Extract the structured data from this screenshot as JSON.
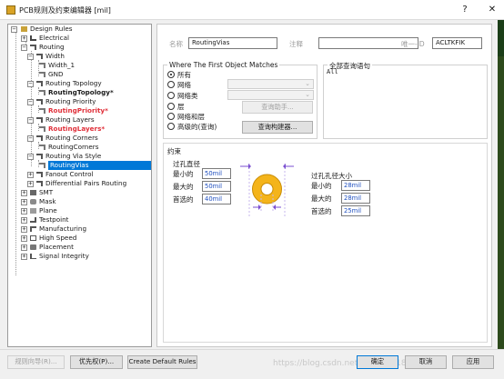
{
  "window": {
    "title": "PCB规则及约束编辑器 [mil]",
    "help_glyph": "?",
    "close_glyph": "✕"
  },
  "tree": {
    "items": [
      {
        "label": "Design Rules",
        "icon": "design-rules-icon",
        "expanded": true
      },
      {
        "label": "Electrical",
        "icon": "electrical-icon",
        "expanded": false
      },
      {
        "label": "Routing",
        "icon": "routing-icon",
        "expanded": true
      },
      {
        "label": "Width",
        "icon": "rule-class-icon",
        "expanded": true
      },
      {
        "label": "Width_1",
        "icon": "rule-icon"
      },
      {
        "label": "GND",
        "icon": "rule-icon"
      },
      {
        "label": "Routing Topology",
        "icon": "rule-class-icon",
        "expanded": true
      },
      {
        "label": "RoutingTopology*",
        "icon": "rule-icon",
        "modified": true
      },
      {
        "label": "Routing Priority",
        "icon": "rule-class-icon",
        "expanded": true
      },
      {
        "label": "RoutingPriority*",
        "icon": "rule-icon",
        "modified": true
      },
      {
        "label": "Routing Layers",
        "icon": "rule-class-icon",
        "expanded": true
      },
      {
        "label": "RoutingLayers*",
        "icon": "rule-icon",
        "modified": true
      },
      {
        "label": "Routing Corners",
        "icon": "rule-class-icon",
        "expanded": true
      },
      {
        "label": "RoutingCorners",
        "icon": "rule-icon"
      },
      {
        "label": "Routing Via Style",
        "icon": "rule-class-icon",
        "expanded": true
      },
      {
        "label": "RoutingVias",
        "icon": "rule-icon",
        "selected": true
      },
      {
        "label": "Fanout Control",
        "icon": "rule-class-icon",
        "expanded": false
      },
      {
        "label": "Differential Pairs Routing",
        "icon": "rule-class-icon",
        "expanded": false
      },
      {
        "label": "SMT",
        "icon": "smt-icon",
        "expanded": false
      },
      {
        "label": "Mask",
        "icon": "mask-icon",
        "expanded": false
      },
      {
        "label": "Plane",
        "icon": "plane-icon",
        "expanded": false
      },
      {
        "label": "Testpoint",
        "icon": "testpoint-icon",
        "expanded": false
      },
      {
        "label": "Manufacturing",
        "icon": "manufacturing-icon",
        "expanded": false
      },
      {
        "label": "High Speed",
        "icon": "high-speed-icon",
        "expanded": false
      },
      {
        "label": "Placement",
        "icon": "placement-icon",
        "expanded": false
      },
      {
        "label": "Signal Integrity",
        "icon": "signal-integrity-icon",
        "expanded": false
      }
    ]
  },
  "rule": {
    "name_label": "名称",
    "name_value": "RoutingVias",
    "comment_label": "注释",
    "comment_value": "",
    "uid_label": "唯一-ID",
    "uid_value": "ACLTKFIK"
  },
  "match": {
    "title": "Where The First Object Matches",
    "options": [
      "所有",
      "网络",
      "网络类",
      "层",
      "网络和层",
      "高级的(查询)"
    ],
    "selected_option": "所有",
    "query_helper": "查询助手...",
    "query_builder": "查询构建器..."
  },
  "full_query": {
    "title": "全部查询语句",
    "text": "All"
  },
  "constraints": {
    "title": "约束",
    "via_diameter": {
      "title": "过孔直径",
      "rows": [
        {
          "label": "最小的",
          "value": "50mil"
        },
        {
          "label": "最大的",
          "value": "50mil"
        },
        {
          "label": "首选的",
          "value": "40mil"
        }
      ]
    },
    "hole_size": {
      "title": "过孔孔径大小",
      "rows": [
        {
          "label": "最小的",
          "value": "28mil"
        },
        {
          "label": "最大的",
          "value": "28mil"
        },
        {
          "label": "首选的",
          "value": "25mil"
        }
      ]
    }
  },
  "footer": {
    "rule_wizard": "规则向导(R)...",
    "priority": "优先权(P)...",
    "create_default": "Create Default Rules",
    "ok": "确定",
    "cancel": "取消",
    "apply": "应用",
    "watermark": "https://blog.csdn.net/qq_24281897"
  }
}
